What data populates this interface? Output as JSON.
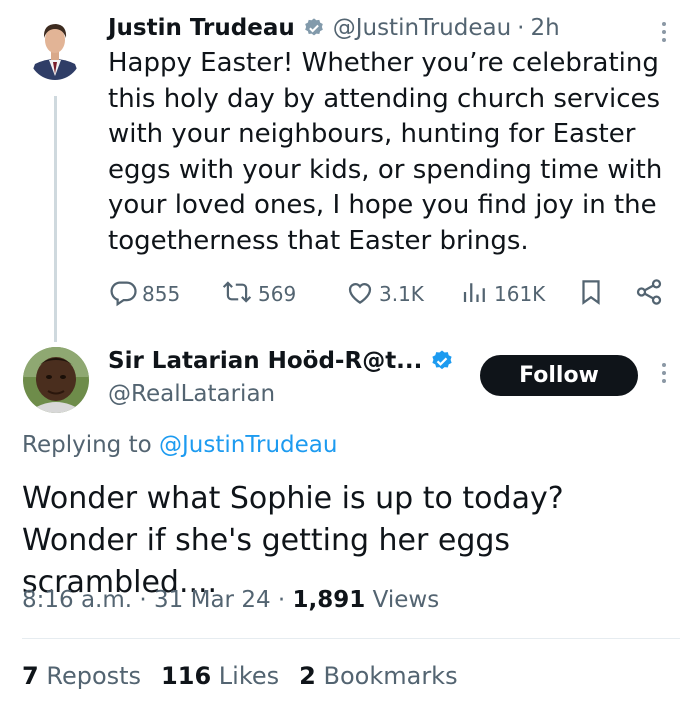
{
  "original_tweet": {
    "author_name": "Justin Trudeau",
    "handle": "@JustinTrudeau",
    "separator": "·",
    "time": "2h",
    "text": "Happy Easter! Whether you’re celebrating this holy day by attending church services with your neighbours, hunting for Easter eggs with your kids, or spending time with your loved ones, I hope you find joy in the togetherness that Easter brings.",
    "actions": {
      "replies": "855",
      "reposts": "569",
      "likes": "3.1K",
      "views": "161K"
    },
    "icons": [
      "avatar",
      "verified-grey-badge-icon",
      "more-icon",
      "reply-icon",
      "repost-icon",
      "like-icon",
      "views-icon",
      "bookmark-icon",
      "share-icon"
    ]
  },
  "reply_tweet": {
    "author_name": "Sir Latarian Hoöd-R@t...",
    "handle": "@RealLatarian",
    "follow_label": "Follow",
    "replying_prefix": "Replying to",
    "replying_to": "@JustinTrudeau",
    "text": "Wonder what Sophie is up to today? Wonder if she's getting her eggs scrambled....",
    "time": "8:16 a.m.",
    "sep1": "·",
    "date": "31 Mar 24",
    "sep2": "·",
    "views_count": "1,891",
    "views_label": "Views",
    "icons": [
      "avatar",
      "verified-blue-badge-icon",
      "more-icon"
    ]
  },
  "stats": {
    "reposts_count": "7",
    "reposts_label": "Reposts",
    "likes_count": "116",
    "likes_label": "Likes",
    "bookmarks_count": "2",
    "bookmarks_label": "Bookmarks"
  },
  "colors": {
    "text": "#0f1419",
    "secondary": "#536471",
    "link": "#1d9bf0",
    "verified_blue": "#1d9bf0",
    "verified_grey": "#829aab",
    "follow_bg": "#0f1419"
  }
}
